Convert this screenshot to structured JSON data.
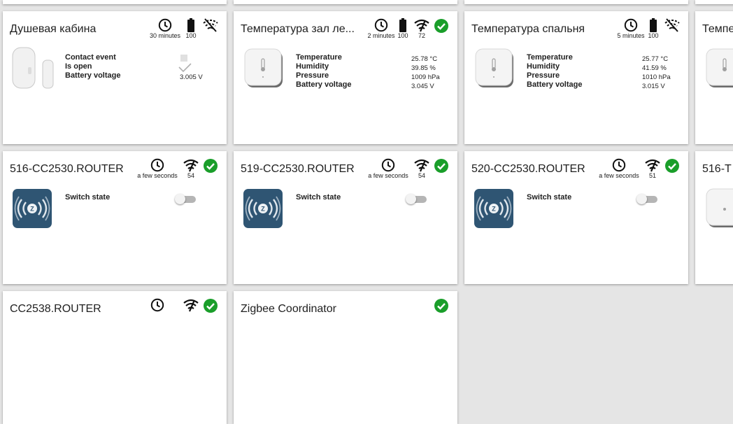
{
  "cards": {
    "shower": {
      "title": "Душевая кабина",
      "last_seen": "30 minutes",
      "battery": "100",
      "labels": [
        "Contact event",
        "Is open",
        "Battery voltage"
      ],
      "battery_voltage": "3.005 V"
    },
    "temp_hall": {
      "title": "Температура зал ле...",
      "last_seen": "2 minutes",
      "battery": "100",
      "link_quality": "72",
      "labels": [
        "Temperature",
        "Humidity",
        "Pressure",
        "Battery voltage"
      ],
      "values": [
        "25.78 °C",
        "39.85 %",
        "1009 hPa",
        "3.045 V"
      ]
    },
    "temp_bedroom": {
      "title": "Температура спальня",
      "last_seen": "5 minutes",
      "battery": "100",
      "labels": [
        "Temperature",
        "Humidity",
        "Pressure",
        "Battery voltage"
      ],
      "values": [
        "25.77 °C",
        "41.59 %",
        "1010 hPa",
        "3.015 V"
      ]
    },
    "temp_partial": {
      "title": "Темпе"
    },
    "router_516": {
      "title": "516-CC2530.ROUTER",
      "last_seen": "a few seconds",
      "link_quality": "54",
      "labels": [
        "Switch state"
      ],
      "switch_on": false
    },
    "router_519": {
      "title": "519-CC2530.ROUTER",
      "last_seen": "a few seconds",
      "link_quality": "54",
      "labels": [
        "Switch state"
      ],
      "switch_on": false
    },
    "router_520": {
      "title": "520-CC2530.ROUTER",
      "last_seen": "a few seconds",
      "link_quality": "51",
      "labels": [
        "Switch state"
      ],
      "switch_on": false
    },
    "partial_516": {
      "title": "516-T"
    },
    "router_2538": {
      "title": "CC2538.ROUTER"
    },
    "coordinator": {
      "title": "Zigbee Coordinator"
    }
  },
  "icons": {
    "last_seen": "clock-icon",
    "battery": "battery-icon",
    "link_quality": "signal-icon",
    "no_link": "signal-off-icon",
    "online": "check-circle-icon"
  },
  "colors": {
    "online": "#1a9e2a",
    "router_tile": "#2f5573",
    "background": "#e5e5e5"
  }
}
